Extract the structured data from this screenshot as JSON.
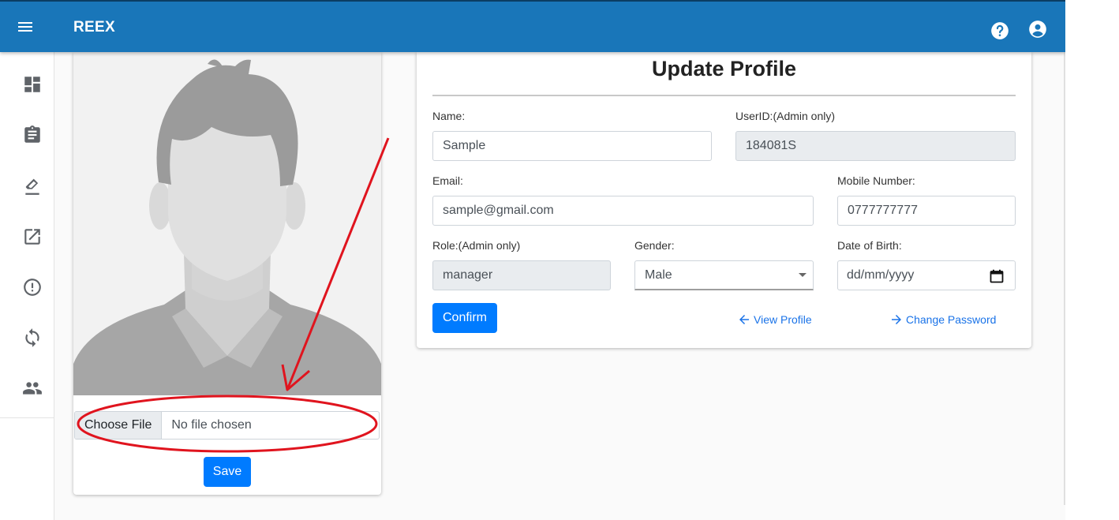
{
  "header": {
    "brand": "REEX",
    "bg_color": "#1976b9",
    "icons": [
      "menu-icon",
      "help-icon",
      "account-icon"
    ]
  },
  "sidebar": {
    "items": [
      {
        "icon": "dashboard-icon"
      },
      {
        "icon": "clipboard-icon"
      },
      {
        "icon": "ink-eraser-icon"
      },
      {
        "icon": "open-in-new-icon"
      },
      {
        "icon": "alert-circle-icon"
      },
      {
        "icon": "sync-icon"
      },
      {
        "icon": "people-icon"
      }
    ]
  },
  "photo_card": {
    "choose_file_label": "Choose File",
    "file_status": "No file chosen",
    "save_label": "Save"
  },
  "form": {
    "title": "Update Profile",
    "name_label": "Name:",
    "name_value": "Sample",
    "userid_label": "UserID:(Admin only)",
    "userid_value": "184081S",
    "email_label": "Email:",
    "email_value": "sample@gmail.com",
    "mobile_label": "Mobile Number:",
    "mobile_value": "0777777777",
    "role_label": "Role:(Admin only)",
    "role_value": "manager",
    "gender_label": "Gender:",
    "gender_value": "Male",
    "dob_label": "Date of Birth:",
    "dob_placeholder": "dd/mm/yyyy",
    "confirm_label": "Confirm",
    "view_profile_label": "View Profile",
    "change_password_label": "Change Password"
  },
  "colors": {
    "primary_button": "#007bff",
    "link": "#1a73e8",
    "annotation_red": "#e0141e"
  }
}
